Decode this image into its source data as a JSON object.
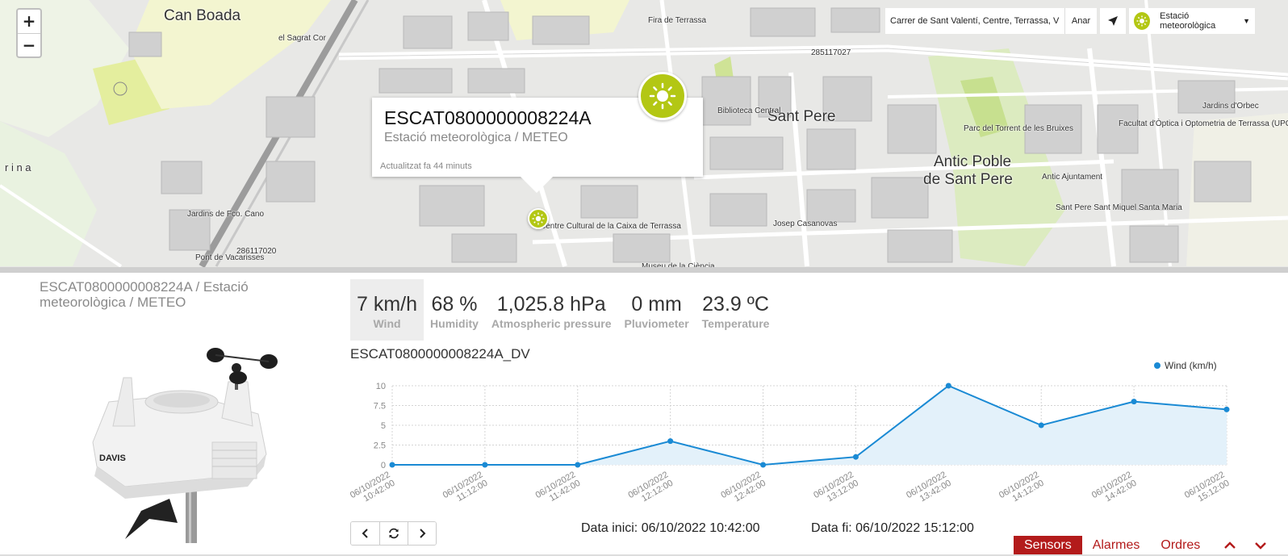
{
  "map": {
    "zoom_in_label": "+",
    "zoom_out_label": "−",
    "address_value": "Carrer de Sant Valentí, Centre, Terrassa, V",
    "go_label": "Anar",
    "layer_label": "Estació meteorològica",
    "place_labels": [
      {
        "text": "Can Boada",
        "size": "big"
      },
      {
        "text": "Sant Pere",
        "size": "big"
      },
      {
        "text": "Antic Poble",
        "size": "big"
      },
      {
        "text": "de Sant Pere",
        "size": "big"
      },
      {
        "text": "r i n a",
        "size": "small"
      },
      {
        "text": "el Sagrat Cor",
        "size": "small"
      },
      {
        "text": "Fira de Terrassa",
        "size": "small"
      },
      {
        "text": "Biblioteca Central",
        "size": "small"
      },
      {
        "text": "Jardins de Fco. Cano",
        "size": "small"
      },
      {
        "text": "Centre Cultural de la Caixa de Terrassa",
        "size": "small"
      },
      {
        "text": "Josep Casanovas",
        "size": "small"
      },
      {
        "text": "Jardins d'Orbec",
        "size": "small"
      },
      {
        "text": "Facultat d'Òptica i Optometria de Terrassa (UPC)",
        "size": "small"
      },
      {
        "text": "Antic Ajuntament",
        "size": "small"
      },
      {
        "text": "Sant Pere Sant Miquel Santa Maria",
        "size": "small"
      },
      {
        "text": "Museu de la Ciència",
        "size": "small"
      },
      {
        "text": "285117027",
        "size": "small"
      },
      {
        "text": "286117020",
        "size": "small"
      },
      {
        "text": "Pont de Vacarisses",
        "size": "small"
      },
      {
        "text": "Parc del Torrent de les Bruixes",
        "size": "small"
      }
    ]
  },
  "popup": {
    "title": "ESCAT0800000008224A",
    "subtitle": "Estació meteorològica / METEO",
    "updated": "Actualitzat fa 44 minuts"
  },
  "station": {
    "title": "ESCAT0800000008224A / Estació meteorològica / METEO"
  },
  "readings": [
    {
      "value": "7 km/h",
      "label": "Wind",
      "active": true
    },
    {
      "value": "68 %",
      "label": "Humidity",
      "active": false
    },
    {
      "value": "1,025.8 hPa",
      "label": "Atmospheric pressure",
      "active": false
    },
    {
      "value": "0 mm",
      "label": "Pluviometer",
      "active": false
    },
    {
      "value": "23.9 ºC",
      "label": "Temperature",
      "active": false
    }
  ],
  "chart_data": {
    "type": "area",
    "title": "ESCAT0800000008224A_DV",
    "xlabel": "",
    "ylabel": "",
    "categories": [
      "06/10/2022 10:42:00",
      "06/10/2022 11:12:00",
      "06/10/2022 11:42:00",
      "06/10/2022 12:12:00",
      "06/10/2022 12:42:00",
      "06/10/2022 13:12:00",
      "06/10/2022 13:42:00",
      "06/10/2022 14:12:00",
      "06/10/2022 14:42:00",
      "06/10/2022 15:12:00"
    ],
    "series": [
      {
        "name": "Wind (km/h)",
        "values": [
          0,
          0,
          0,
          3,
          0,
          1,
          10,
          5,
          8,
          7
        ]
      }
    ],
    "ylim": [
      0,
      10
    ],
    "yticks": [
      "0",
      "2.5",
      "5",
      "7.5",
      "10"
    ],
    "grid": true,
    "legend": "top-right",
    "color": "#1a8ad4",
    "fill": "#e3f1fa"
  },
  "dates": {
    "start": "Data inici: 06/10/2022 10:42:00",
    "end": "Data fi: 06/10/2022 15:12:00"
  },
  "tabs": [
    {
      "label": "Sensors",
      "active": true
    },
    {
      "label": "Alarmes",
      "active": false
    },
    {
      "label": "Ordres",
      "active": false
    }
  ],
  "icons": {
    "prev": "chevron-left-icon",
    "refresh": "refresh-icon",
    "next": "chevron-right-icon",
    "up": "chevron-up-icon",
    "down": "chevron-down-icon",
    "locate": "locate-arrow-icon",
    "sun": "sun-icon"
  },
  "colors": {
    "accent": "#b31b1b",
    "station_icon": "#b3c714"
  }
}
